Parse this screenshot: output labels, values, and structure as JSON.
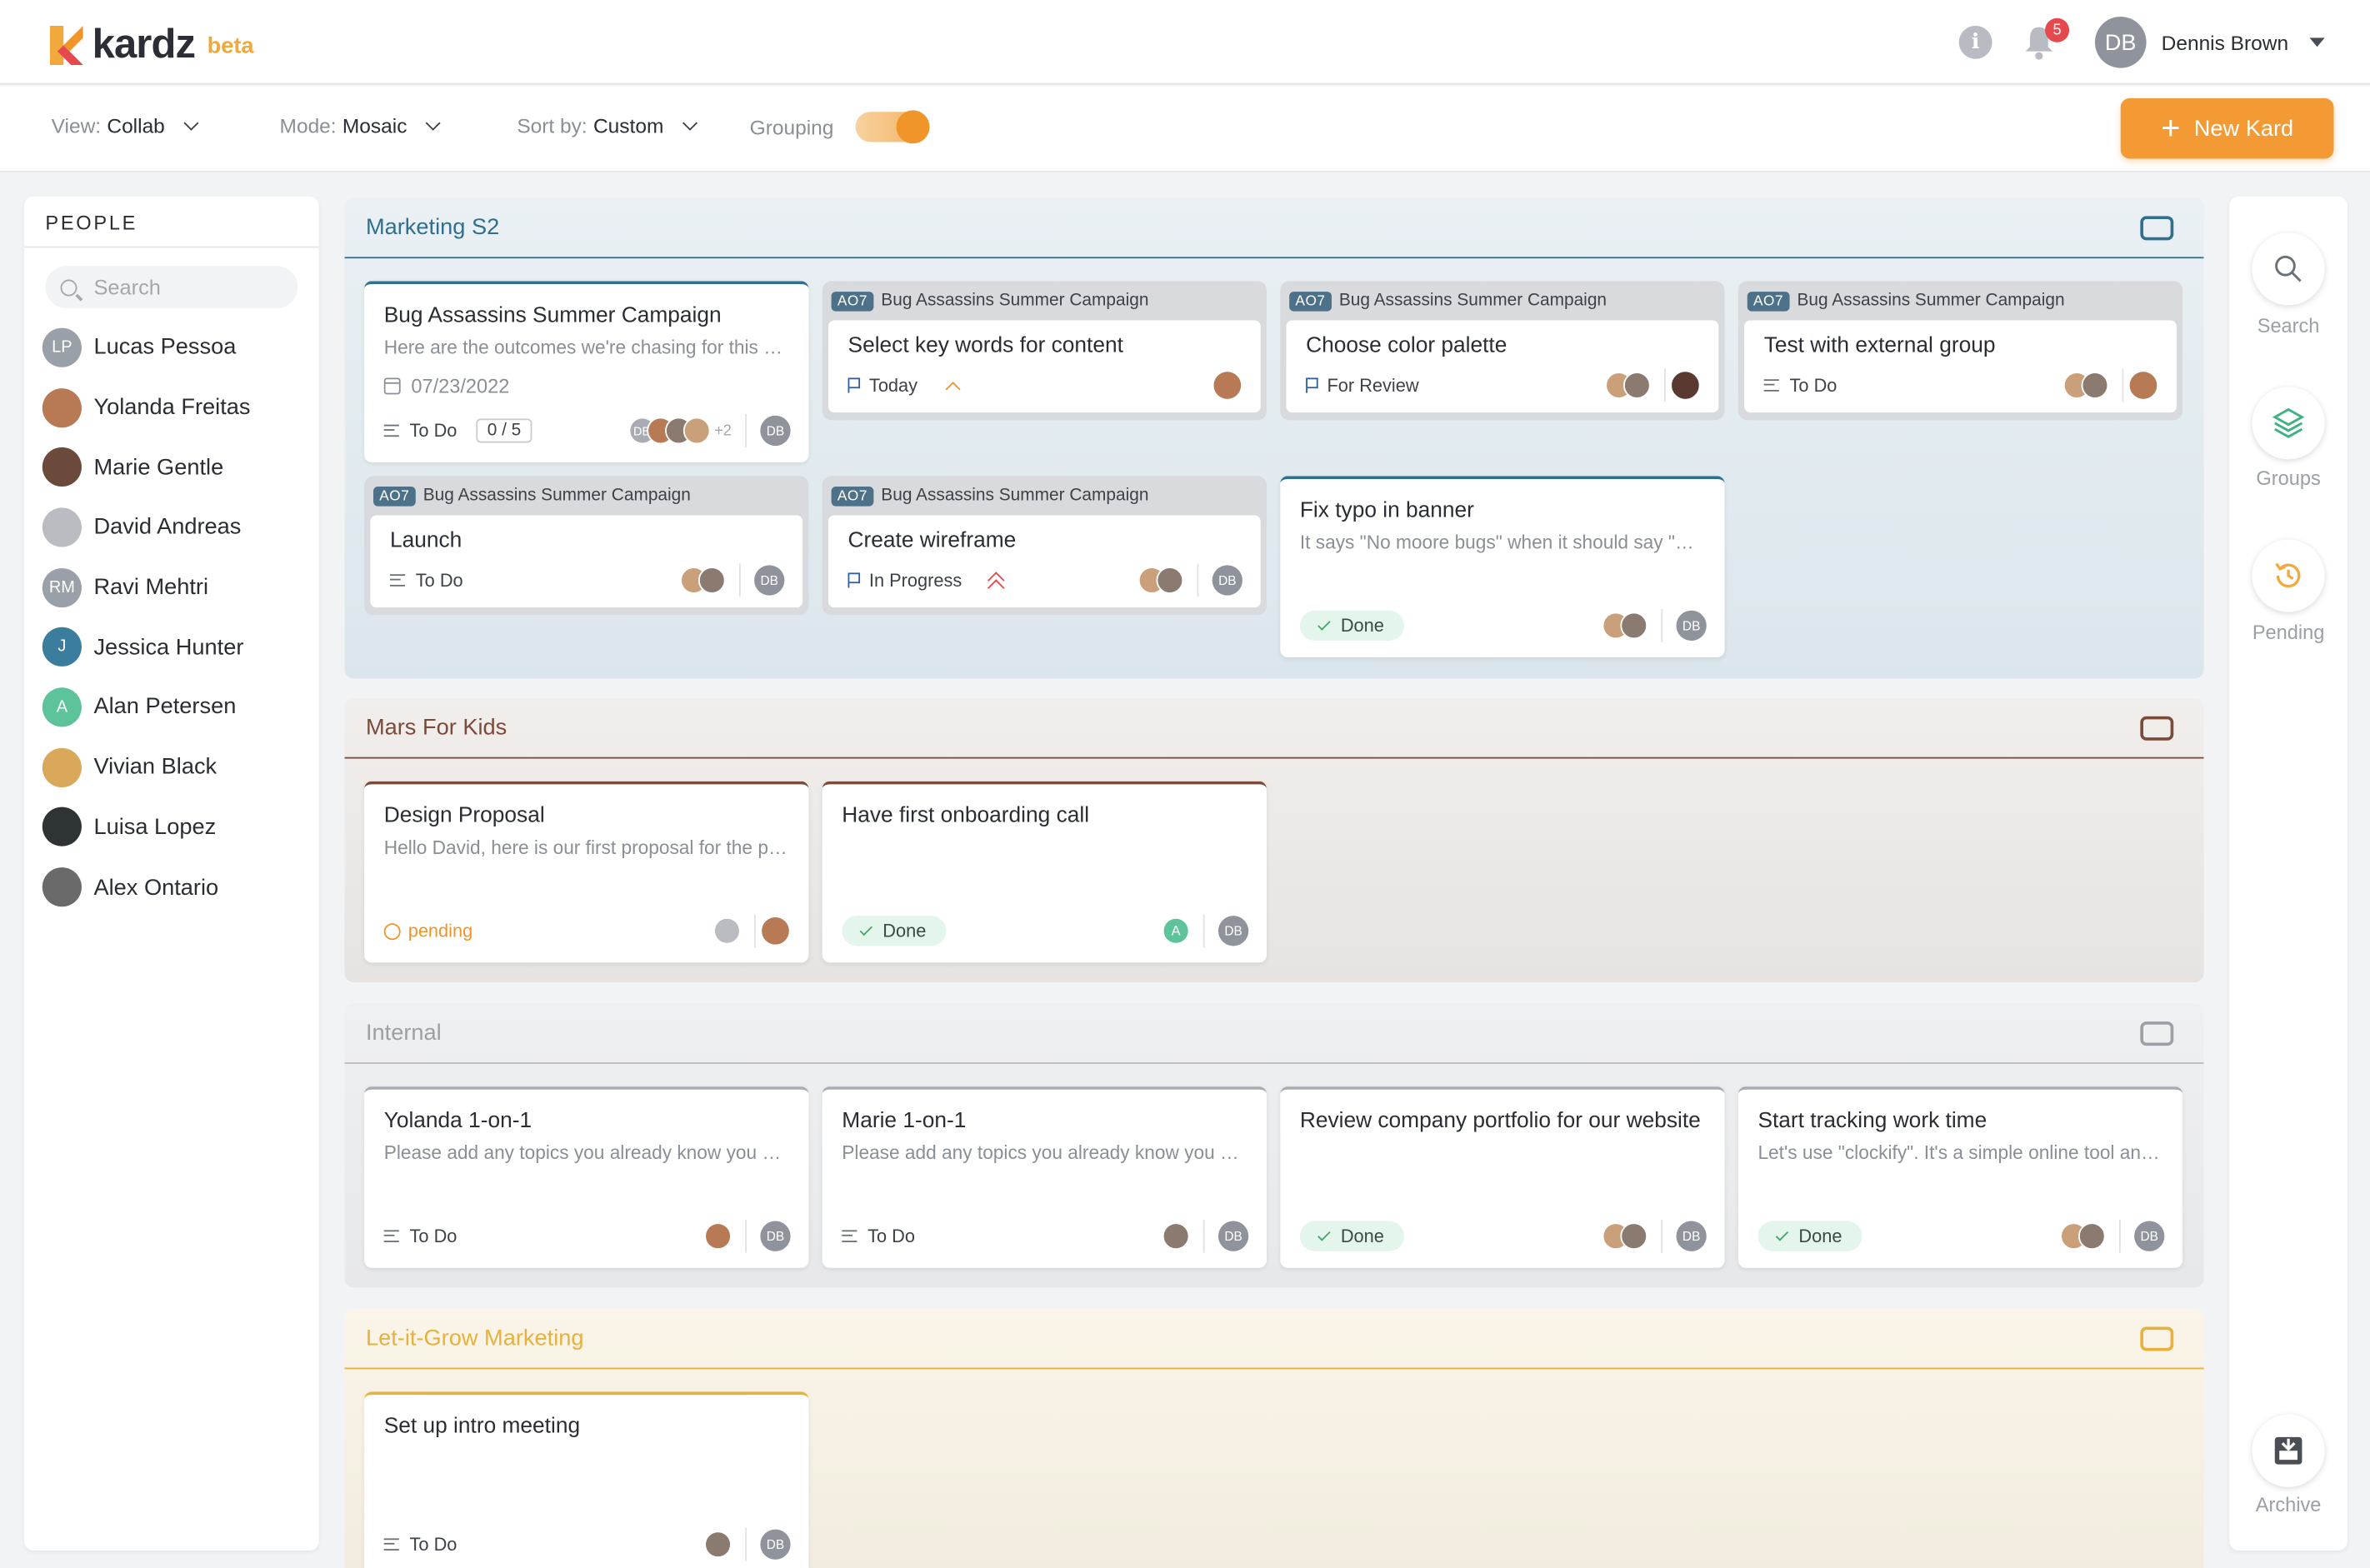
{
  "app": {
    "logo": "kardz",
    "beta": "beta"
  },
  "header": {
    "info_icon": "info-icon",
    "notifications": "5",
    "user_initials": "DB",
    "user_name": "Dennis Brown"
  },
  "toolbar": {
    "view_label": "View:",
    "view_value": "Collab",
    "mode_label": "Mode:",
    "mode_value": "Mosaic",
    "sort_label": "Sort by:",
    "sort_value": "Custom",
    "grouping_label": "Grouping",
    "grouping_on": true,
    "new_kard": "New Kard"
  },
  "people": {
    "title": "PEOPLE",
    "search_placeholder": "Search",
    "items": [
      {
        "name": "Lucas Pessoa",
        "initials": "LP",
        "color": "#9aa0a8"
      },
      {
        "name": "Yolanda Freitas",
        "initials": "",
        "color": "#b77a55"
      },
      {
        "name": "Marie Gentle",
        "initials": "",
        "color": "#6b4a3c"
      },
      {
        "name": "David Andreas",
        "initials": "",
        "color": "#b9bcc0"
      },
      {
        "name": "Ravi Mehtri",
        "initials": "RM",
        "color": "#9aa0a8"
      },
      {
        "name": "Jessica Hunter",
        "initials": "J",
        "color": "#3a7d9c"
      },
      {
        "name": "Alan Petersen",
        "initials": "A",
        "color": "#5cc39a"
      },
      {
        "name": "Vivian Black",
        "initials": "",
        "color": "#d9a85a"
      },
      {
        "name": "Luisa Lopez",
        "initials": "",
        "color": "#2e3436"
      },
      {
        "name": "Alex Ontario",
        "initials": "",
        "color": "#6a6a6a"
      }
    ]
  },
  "rail": {
    "search": "Search",
    "groups": "Groups",
    "pending": "Pending",
    "archive": "Archive"
  },
  "groups": {
    "marketing": {
      "title": "Marketing S2",
      "c1": {
        "title": "Bug Assassins Summer Campaign",
        "desc": "Here are the outcomes we're chasing for this summer campaign",
        "date": "07/23/2022",
        "status": "To Do",
        "count": "0 / 5",
        "more": "+2",
        "db": "DB"
      },
      "c2": {
        "tag": "AO7",
        "parent": "Bug Assassins Summer Campaign",
        "title": "Select key words for content",
        "status": "Today"
      },
      "c3": {
        "tag": "AO7",
        "parent": "Bug Assassins Summer Campaign",
        "title": "Choose color palette",
        "status": "For Review"
      },
      "c4": {
        "tag": "AO7",
        "parent": "Bug Assassins Summer Campaign",
        "title": "Test with external group",
        "status": "To Do"
      },
      "c5": {
        "tag": "AO7",
        "parent": "Bug Assassins Summer Campaign",
        "title": "Launch",
        "status": "To Do",
        "db": "DB"
      },
      "c6": {
        "tag": "AO7",
        "parent": "Bug Assassins Summer Campaign",
        "title": "Create wireframe",
        "status": "In Progress",
        "db": "DB"
      },
      "c7": {
        "title": "Fix typo in banner",
        "desc": "It says \"No moore bugs\" when it should say \"No more bugs\"",
        "status": "Done",
        "db": "DB"
      }
    },
    "mars": {
      "title": "Mars For Kids",
      "c1": {
        "title": "Design Proposal",
        "desc": "Hello David, here is our first proposal for the project",
        "status": "pending"
      },
      "c2": {
        "title": "Have first onboarding call",
        "status": "Done",
        "av": "A",
        "db": "DB"
      }
    },
    "internal": {
      "title": "Internal",
      "c1": {
        "title": "Yolanda 1-on-1",
        "desc": "Please add any topics you already know you want to discuss",
        "status": "To Do",
        "db": "DB"
      },
      "c2": {
        "title": "Marie 1-on-1",
        "desc": "Please add any topics you already know you want to discuss",
        "status": "To Do",
        "db": "DB"
      },
      "c3": {
        "title": "Review company portfolio for our website",
        "status": "Done",
        "db": "DB"
      },
      "c4": {
        "title": "Start tracking work time",
        "desc": "Let's use \"clockify\". It's a simple online tool and free",
        "status": "Done",
        "db": "DB"
      }
    },
    "letitgrow": {
      "title": "Let-it-Grow Marketing",
      "c1": {
        "title": "Set up intro meeting",
        "status": "To Do",
        "db": "DB"
      }
    }
  },
  "colors": {
    "accent": "#f39a35",
    "marketing": "#2f6f8f",
    "mars": "#7a4a3a",
    "internal": "#9aa0a6",
    "letitgrow": "#e8b13a"
  }
}
